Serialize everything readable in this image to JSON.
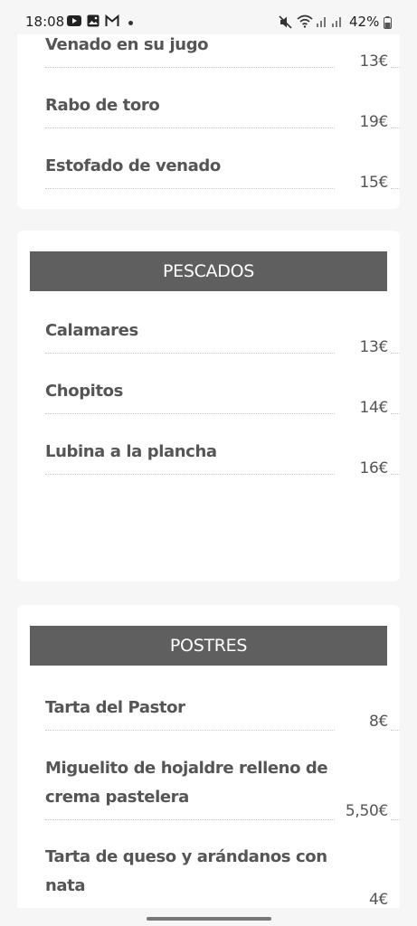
{
  "status_bar": {
    "time": "18:08",
    "left_icons": [
      "youtube-icon",
      "gallery-icon",
      "gmail-icon"
    ],
    "right_icons": [
      "mute-icon",
      "wifi-icon",
      "signal-icon",
      "signal-icon",
      "battery-icon"
    ],
    "battery": "42%"
  },
  "sections": [
    {
      "title": "",
      "items": [
        {
          "name": "Venado en su jugo",
          "price": "13€"
        },
        {
          "name": "Rabo de toro",
          "price": "19€"
        },
        {
          "name": "Estofado de venado",
          "price": "15€"
        }
      ]
    },
    {
      "title": "PESCADOS",
      "items": [
        {
          "name": "Calamares",
          "price": "13€"
        },
        {
          "name": "Chopitos",
          "price": "14€"
        },
        {
          "name": "Lubina a la plancha",
          "price": "16€"
        }
      ]
    },
    {
      "title": "POSTRES",
      "items": [
        {
          "name": "Tarta del Pastor",
          "price": "8€"
        },
        {
          "name": "Miguelito de hojaldre relleno de crema pastelera",
          "price": "5,50€"
        },
        {
          "name": "Tarta de queso y arándanos con nata",
          "price": "4€"
        }
      ]
    }
  ],
  "colors": {
    "header_bg": "#5f5f5f",
    "text": "#555555",
    "page_bg": "#f6f6f7"
  }
}
